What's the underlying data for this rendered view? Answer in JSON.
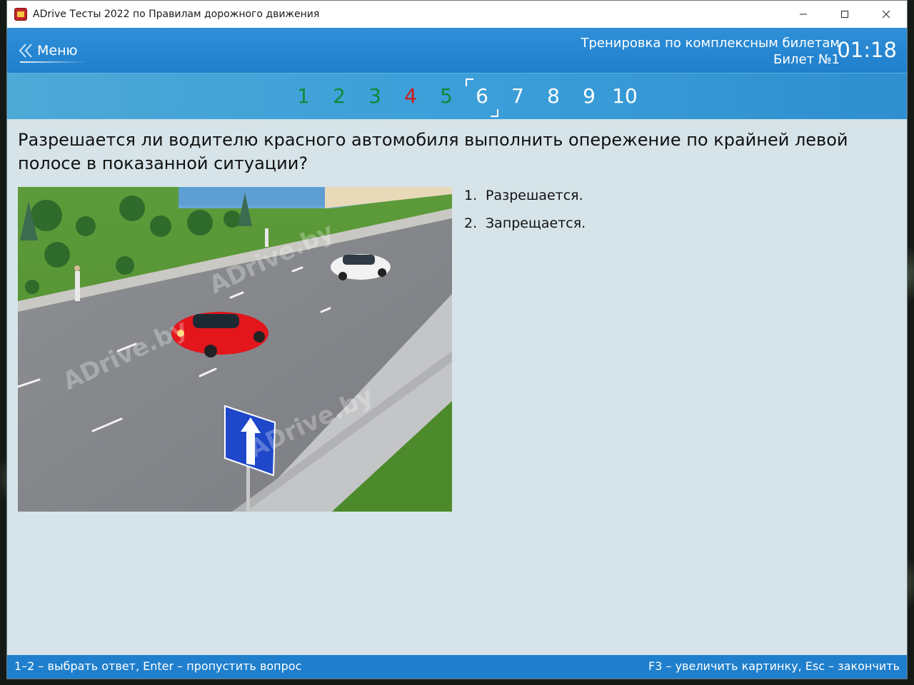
{
  "window": {
    "title": "ADrive Тесты 2022 по Правилам дорожного движения",
    "controls": [
      "minimize-icon",
      "maximize-icon",
      "close-icon"
    ]
  },
  "header": {
    "menu_label": "Меню",
    "mode_line1": "Тренировка по комплексным билетам",
    "mode_line2": "Билет №1",
    "timer": "01:18"
  },
  "tickets": [
    {
      "label": "1",
      "status": "correct"
    },
    {
      "label": "2",
      "status": "correct"
    },
    {
      "label": "3",
      "status": "correct"
    },
    {
      "label": "4",
      "status": "wrong"
    },
    {
      "label": "5",
      "status": "correct"
    },
    {
      "label": "6",
      "status": "current"
    },
    {
      "label": "7",
      "status": "unanswered"
    },
    {
      "label": "8",
      "status": "unanswered"
    },
    {
      "label": "9",
      "status": "unanswered"
    },
    {
      "label": "10",
      "status": "unanswered"
    }
  ],
  "question": {
    "text": "Разрешается ли водителю красного автомобиля выполнить опережение по крайней левой полосе в показанной ситуации?",
    "watermark": "ADrive.by"
  },
  "answers": [
    {
      "num": "1.",
      "text": "Разрешается."
    },
    {
      "num": "2.",
      "text": "Запрещается."
    }
  ],
  "footer": {
    "left_hint": "1–2 – выбрать ответ, Enter – пропустить вопрос",
    "right_hint": "F3 – увеличить картинку, Esc – закончить"
  },
  "colors": {
    "header_blue": "#1f7fcc",
    "correct": "#0d8a3a",
    "wrong": "#d11a1a",
    "content_bg": "#d6e4e9"
  }
}
